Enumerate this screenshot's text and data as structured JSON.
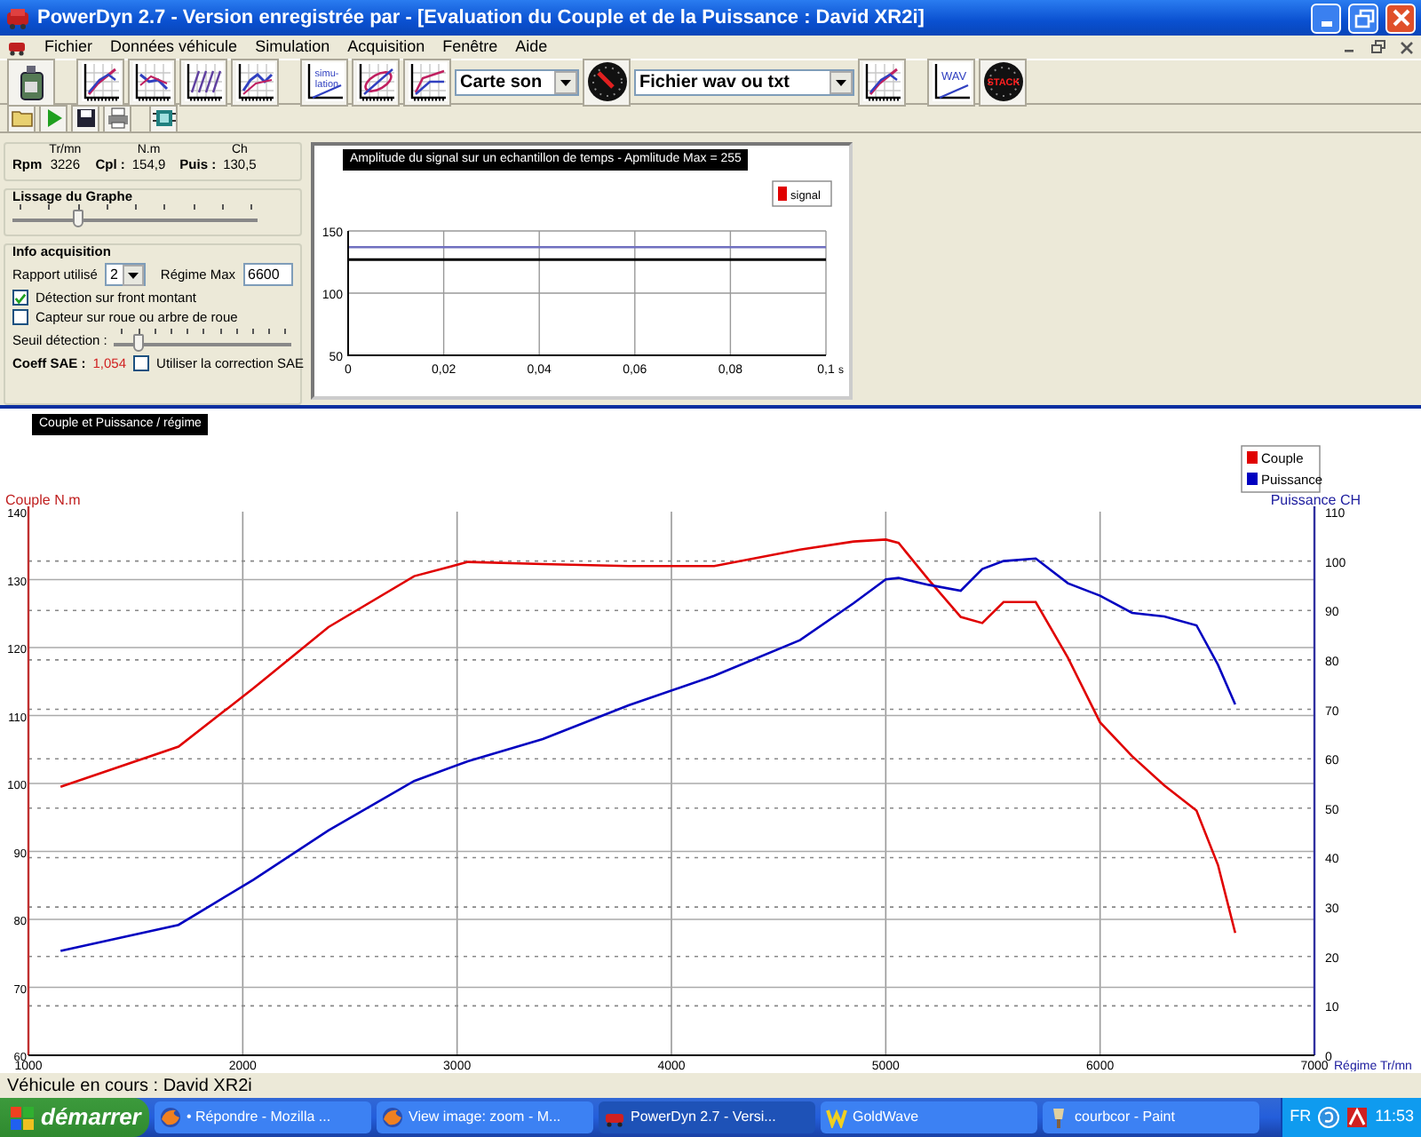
{
  "window": {
    "title": "PowerDyn 2.7 - Version enregistrée par  - [Evaluation du Couple et de la Puissance : David XR2i]"
  },
  "menu": [
    "Fichier",
    "Données véhicule",
    "Simulation",
    "Acquisition",
    "Fenêtre",
    "Aide"
  ],
  "toolbar": [
    {
      "kind": "oilcan"
    },
    {
      "kind": "separator"
    },
    {
      "kind": "graph"
    },
    {
      "kind": "graph"
    },
    {
      "kind": "graph"
    },
    {
      "kind": "graph"
    },
    {
      "kind": "separator"
    },
    {
      "kind": "text-graph",
      "lines": [
        "simu-",
        "lation"
      ]
    },
    {
      "kind": "graph"
    },
    {
      "kind": "graph"
    },
    {
      "kind": "select",
      "value": "Carte son"
    },
    {
      "kind": "gauge"
    },
    {
      "kind": "select",
      "value": "Fichier wav ou txt"
    },
    {
      "kind": "graph"
    },
    {
      "kind": "separator"
    },
    {
      "kind": "text-graph",
      "lines": [
        "WAV"
      ]
    },
    {
      "kind": "stack-gauge",
      "label": "STACK"
    }
  ],
  "toolbar2": [
    {
      "kind": "folder"
    },
    {
      "kind": "play"
    },
    {
      "kind": "save"
    },
    {
      "kind": "print"
    },
    {
      "kind": "separator"
    },
    {
      "kind": "chip"
    }
  ],
  "readout": [
    {
      "label": "Rpm",
      "unit": "Tr/mn",
      "value": "3226"
    },
    {
      "label": "Cpl :",
      "unit": "N.m",
      "value": "154,9"
    },
    {
      "label": "Puis :",
      "unit": "Ch",
      "value": "130,5"
    }
  ],
  "smoothing": {
    "title": "Lissage du Graphe",
    "level": 0.25
  },
  "acquisition": {
    "title": "Info acquisition",
    "ratio_label": "Rapport utilisé",
    "ratio": "2",
    "max_label": "Régime Max",
    "max_rpm": "6600",
    "options": [
      {
        "label": "Détection sur front montant",
        "checked": true
      },
      {
        "label": "Capteur sur roue ou arbre de roue",
        "checked": false
      }
    ],
    "threshold_label": "Seuil détection :",
    "threshold": {
      "level": 0.1
    }
  },
  "sae": {
    "label": "Coeff SAE :",
    "value": "1,054",
    "option": {
      "label": "Utiliser la correction SAE",
      "checked": false
    }
  },
  "signal_panel": {
    "title": "Amplitude du signal sur un echantillon de temps - Apmlitude Max = 255",
    "legend": [
      {
        "name": "signal",
        "color": "#e00000"
      }
    ],
    "chart_data": {
      "type": "line",
      "xlabel": "s",
      "xlim": [
        0,
        0.1
      ],
      "ylim": [
        50,
        150
      ],
      "xticks": [
        0,
        {
          "value": 0.02,
          "label": "0,02"
        },
        {
          "value": 0.04,
          "label": "0,04"
        },
        {
          "value": 0.06,
          "label": "0,06"
        },
        {
          "value": 0.08,
          "label": "0,08"
        },
        {
          "value": 0.1,
          "label": "0,1"
        }
      ],
      "yticks": [
        50,
        100,
        150
      ],
      "grid": true,
      "ref_lines": [
        {
          "value": 137,
          "axis": "y",
          "color": "#7070c0"
        },
        {
          "value": 127,
          "axis": "y",
          "color": "#000000"
        }
      ]
    }
  },
  "graph_panel": {
    "tab": "Couple et Puissance / régime",
    "chart_data": {
      "type": "line",
      "xlabel": "Régime Tr/mn",
      "ylabel": "Couple N.m",
      "y2label": "Puissance CH",
      "xlim": [
        1000,
        7000
      ],
      "ylim": [
        60,
        140
      ],
      "y2lim": [
        0,
        110
      ],
      "grid": true,
      "legend": "upper right",
      "xticks": [
        1000,
        2000,
        3000,
        4000,
        5000,
        6000,
        7000
      ],
      "yticks": [
        60,
        70,
        80,
        90,
        100,
        110,
        120,
        130,
        140
      ],
      "y2ticks": [
        0,
        10,
        20,
        30,
        40,
        50,
        60,
        70,
        80,
        90,
        100,
        110
      ],
      "x": [
        1150,
        1700,
        2050,
        2400,
        2800,
        3050,
        3400,
        3800,
        4200,
        4600,
        4850,
        5000,
        5060,
        5200,
        5350,
        5450,
        5550,
        5700,
        5850,
        6000,
        6150,
        6300,
        6450,
        6550,
        6630
      ],
      "series": [
        {
          "name": "Couple",
          "color": "#e00000",
          "values": [
            99.5,
            105.4,
            114,
            123,
            130.5,
            132.6,
            132.3,
            132,
            132,
            134.4,
            135.6,
            135.9,
            135.4,
            130,
            124.5,
            123.6,
            126.7,
            126.7,
            118.5,
            109,
            104,
            99.7,
            96,
            88,
            78
          ]
        },
        {
          "name": "Puissance",
          "color": "#0000c0",
          "axis": "y2",
          "values": [
            21.1,
            26.4,
            35.5,
            45.5,
            55.5,
            59.5,
            64,
            70.8,
            76.8,
            84,
            91.5,
            96.3,
            96.6,
            95.2,
            94,
            98.4,
            100,
            100.5,
            95.5,
            93,
            89.5,
            88.8,
            87,
            79,
            71
          ]
        }
      ]
    }
  },
  "status_bar": "Véhicule en cours : David XR2i",
  "taskbar": {
    "start": "démarrer",
    "tasks": [
      {
        "label": "• Répondre - Mozilla ...",
        "kind": "browser",
        "selected": false
      },
      {
        "label": "View image: zoom - M...",
        "kind": "browser",
        "selected": false
      },
      {
        "label": "PowerDyn 2.7 - Versi...",
        "kind": "app",
        "selected": true
      },
      {
        "label": "GoldWave",
        "kind": "wave",
        "selected": false
      },
      {
        "label": "courbcor - Paint",
        "kind": "paint",
        "selected": false
      }
    ],
    "language": "FR",
    "clock": "11:53"
  }
}
